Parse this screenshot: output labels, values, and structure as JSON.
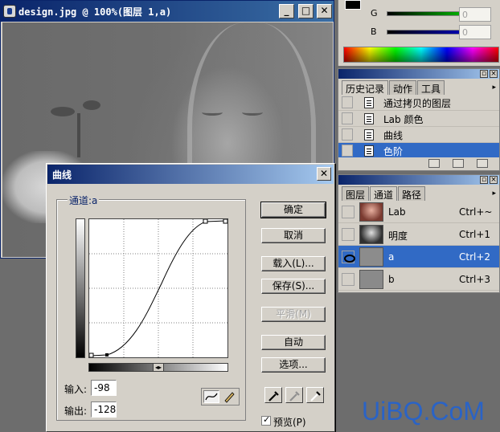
{
  "document": {
    "title": "design.jpg @ 100%(图层 1,a)",
    "minimize": "_",
    "maximize": "□",
    "close": "✕"
  },
  "color_panel": {
    "sliders": [
      {
        "label": "G",
        "value": "0",
        "color": "#00cc00"
      },
      {
        "label": "B",
        "value": "0",
        "color": "#0000cc"
      }
    ]
  },
  "history_panel": {
    "tabs": [
      "历史记录",
      "动作",
      "工具"
    ],
    "active_tab": "历史记录",
    "items": [
      {
        "label": "通过拷贝的图层",
        "selected": false
      },
      {
        "label": "Lab 颜色",
        "selected": false
      },
      {
        "label": "曲线",
        "selected": false
      },
      {
        "label": "色阶",
        "selected": true
      }
    ]
  },
  "channels_panel": {
    "tabs": [
      "图层",
      "通道",
      "路径"
    ],
    "active_tab": "通道",
    "items": [
      {
        "label": "Lab",
        "shortcut": "Ctrl+~",
        "selected": false,
        "visible": false
      },
      {
        "label": "明度",
        "shortcut": "Ctrl+1",
        "selected": false,
        "visible": false
      },
      {
        "label": "a",
        "shortcut": "Ctrl+2",
        "selected": true,
        "visible": true
      },
      {
        "label": "b",
        "shortcut": "Ctrl+3",
        "selected": false,
        "visible": false
      }
    ]
  },
  "curves_dialog": {
    "title": "曲线",
    "channel_label": "通道:a",
    "input_label": "输入:",
    "input_value": "-98",
    "output_label": "输出:",
    "output_value": "-128",
    "buttons": {
      "ok": "确定",
      "cancel": "取消",
      "load": "载入(L)...",
      "save": "保存(S)...",
      "smooth": "平滑(M)",
      "auto": "自动",
      "options": "选项..."
    },
    "preview_label": "预览(P)",
    "preview_checked": true
  },
  "watermark": "UiBQ.CoM"
}
